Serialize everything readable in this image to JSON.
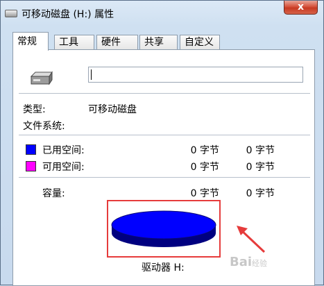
{
  "window": {
    "title": "可移动磁盘 (H:) 属性",
    "close_glyph": "x"
  },
  "tabs": [
    {
      "label": "常规",
      "active": true
    },
    {
      "label": "工具",
      "active": false
    },
    {
      "label": "硬件",
      "active": false
    },
    {
      "label": "共享",
      "active": false
    },
    {
      "label": "自定义",
      "active": false
    }
  ],
  "general": {
    "name_value": "",
    "type_label": "类型:",
    "type_value": "可移动磁盘",
    "fs_label": "文件系统:",
    "fs_value": "",
    "used_label": "已用空间:",
    "used_bytes": "0 字节",
    "used_size": "0 字节",
    "used_color": "#0000ff",
    "free_label": "可用空间:",
    "free_bytes": "0 字节",
    "free_size": "0 字节",
    "free_color": "#ff00ff",
    "capacity_label": "容量:",
    "capacity_bytes": "0 字节",
    "capacity_size": "0 字节",
    "drive_label": "驱动器 H:"
  },
  "chart_data": {
    "type": "pie",
    "series": [
      {
        "name": "已用空间",
        "values": [
          0
        ],
        "color": "#0000ff"
      },
      {
        "name": "可用空间",
        "values": [
          0
        ],
        "color": "#ff00ff"
      }
    ]
  },
  "watermark": {
    "text": "Bai",
    "sub": "经验"
  }
}
